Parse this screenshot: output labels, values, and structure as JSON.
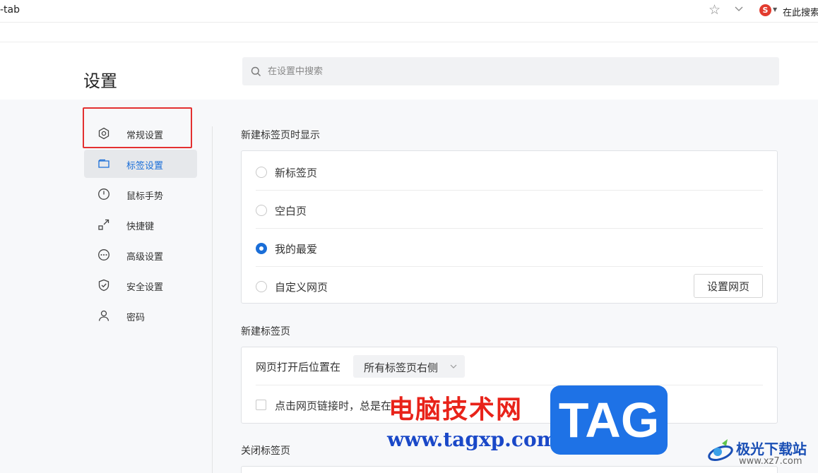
{
  "browser": {
    "url_fragment": "-tab",
    "search_engine_letter": "S",
    "top_search_label": "在此搜索"
  },
  "header": {
    "title": "设置",
    "search_placeholder": "在设置中搜索"
  },
  "sidebar": {
    "items": [
      {
        "label": "常规设置",
        "icon": "gear-icon",
        "active": false
      },
      {
        "label": "标签设置",
        "icon": "tab-icon",
        "active": true
      },
      {
        "label": "鼠标手势",
        "icon": "mouse-icon",
        "active": false
      },
      {
        "label": "快捷键",
        "icon": "shortcut-icon",
        "active": false
      },
      {
        "label": "高级设置",
        "icon": "more-icon",
        "active": false
      },
      {
        "label": "安全设置",
        "icon": "shield-icon",
        "active": false
      },
      {
        "label": "密码",
        "icon": "user-icon",
        "active": false
      }
    ]
  },
  "sections": {
    "new_tab_display": {
      "title": "新建标签页时显示",
      "options": [
        "新标签页",
        "空白页",
        "我的最爱",
        "自定义网页"
      ],
      "selected": "我的最爱",
      "button": "设置网页"
    },
    "new_tab": {
      "title": "新建标签页",
      "position_label": "网页打开后位置在",
      "position_value": "所有标签页右侧",
      "checkbox_label": "点击网页链接时，总是在"
    },
    "close_tab": {
      "title": "关闭标签页"
    }
  },
  "watermark": {
    "cn_text": "电脑技术网",
    "url": "www.tagxp.com",
    "tag": "TAG",
    "brand": "极光下载站",
    "brand_site": "www.xz7.com"
  },
  "colors": {
    "accent": "#1a6ed8",
    "highlight": "#e33030",
    "watermark_red": "#e8231a",
    "watermark_blue": "#1e72e6"
  }
}
